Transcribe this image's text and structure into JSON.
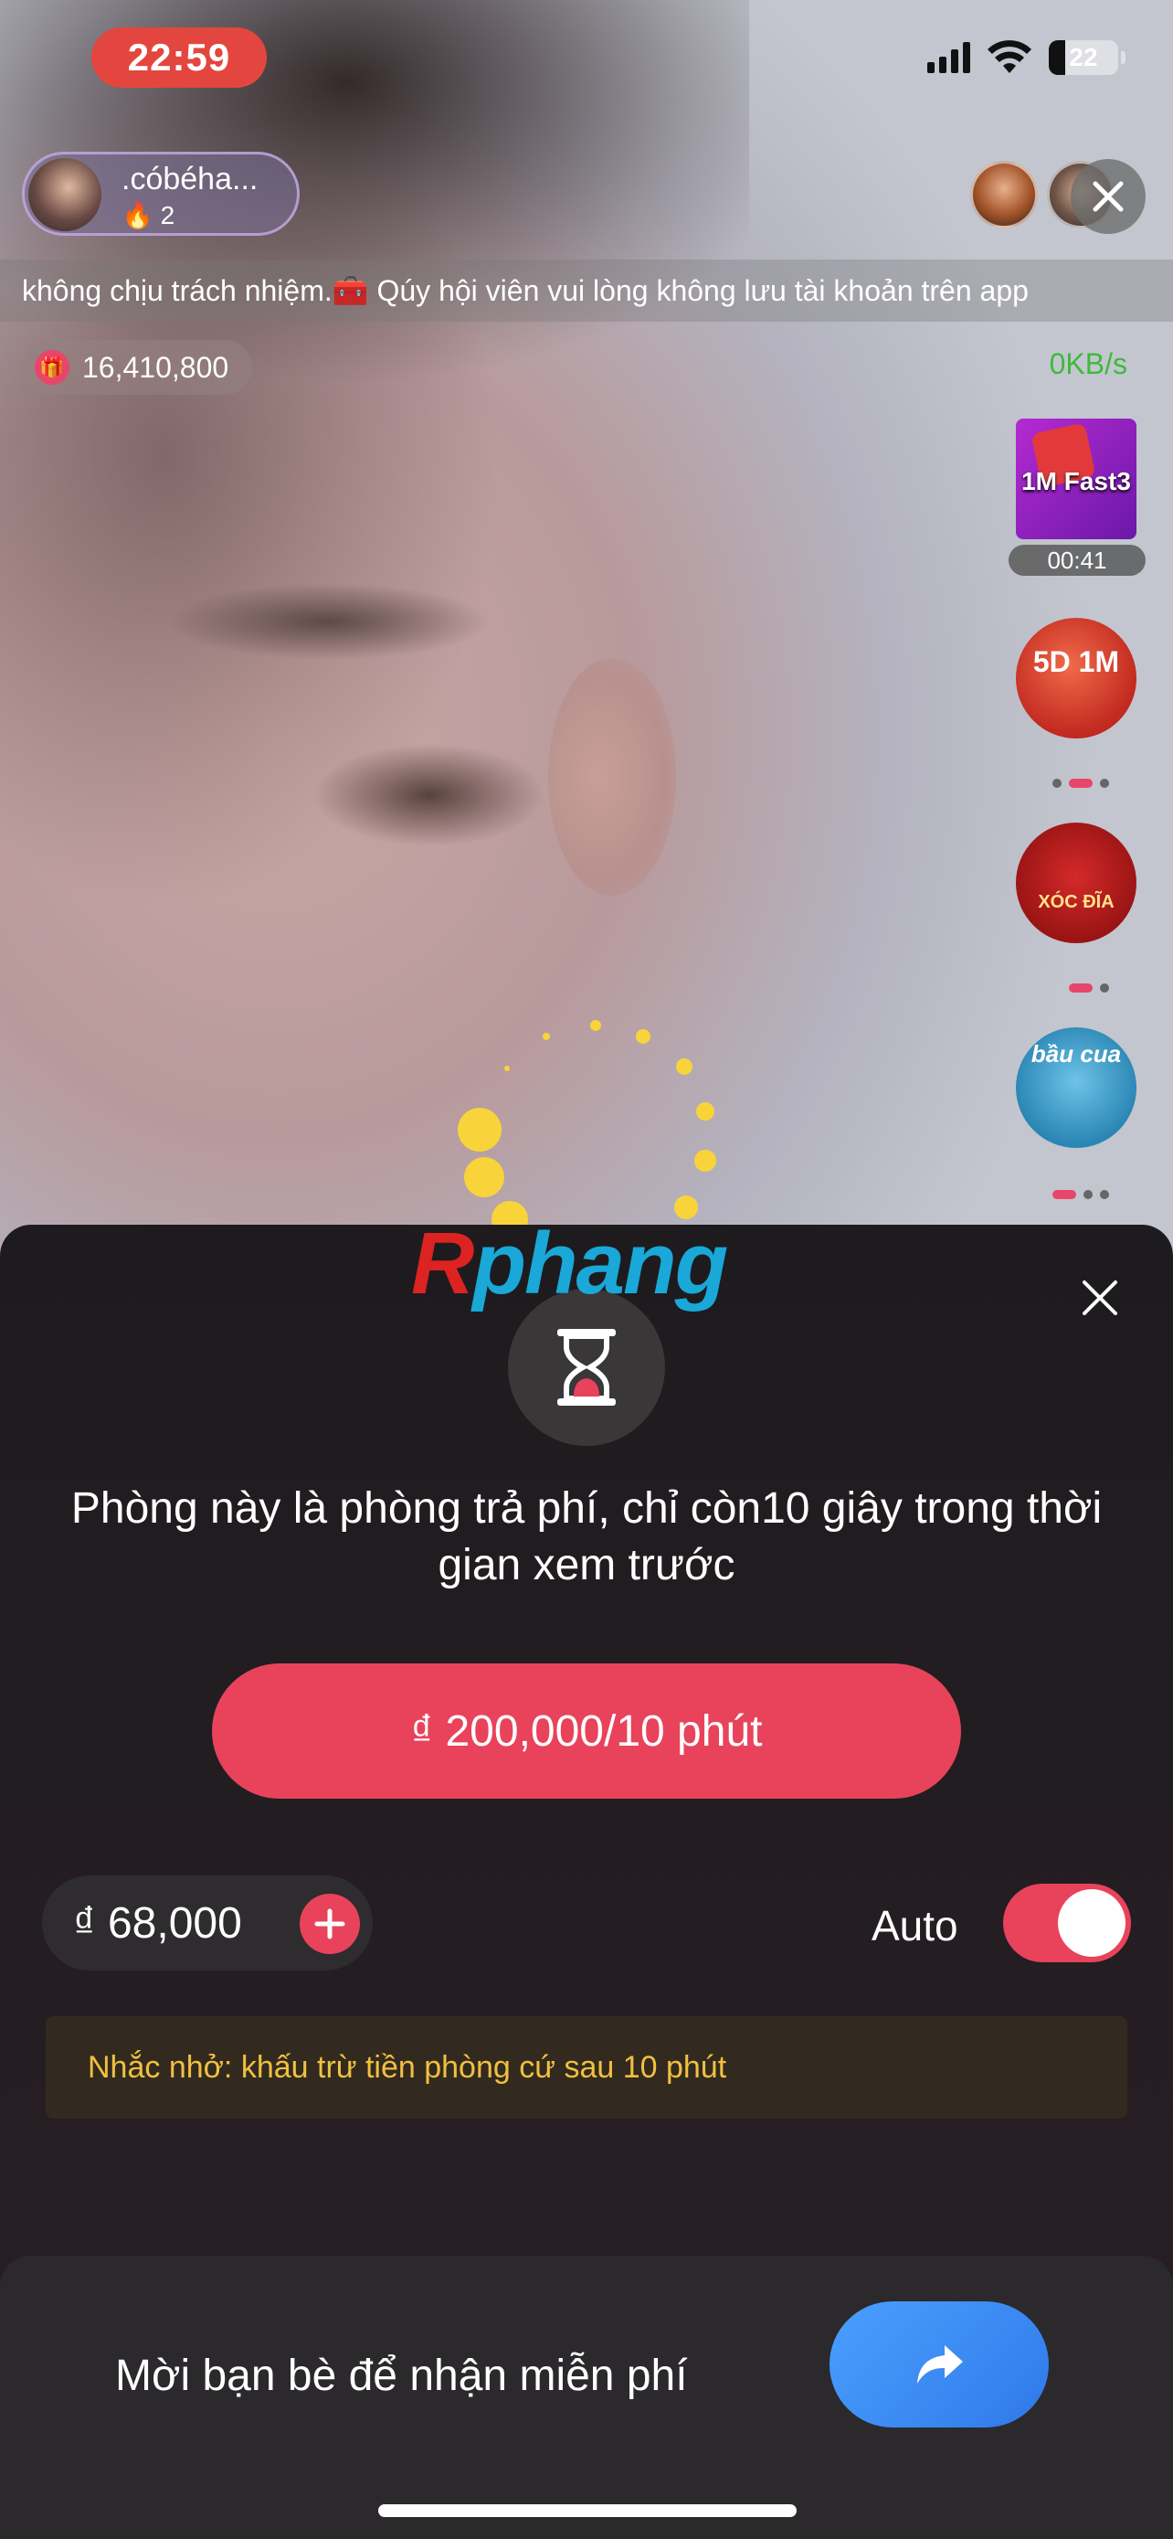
{
  "status_bar": {
    "time": "22:59",
    "battery": "22"
  },
  "streamer": {
    "name": ".cóbéha...",
    "fans": "2",
    "fan_icon": "flame-icon"
  },
  "ticker": {
    "text": "không chịu trách nhiệm.🧰 Qúy hội viên vui lòng không lưu tài khoản trên app"
  },
  "gift": {
    "count": "16,410,800",
    "icon": "gift-icon"
  },
  "network_speed": "0KB/s",
  "games": [
    {
      "label": "1M Fast3",
      "timer": "00:41"
    },
    {
      "label": "5D 1M"
    },
    {
      "label": "XÓC ĐĨA"
    },
    {
      "label": "bầu cua"
    }
  ],
  "watermark": {
    "part1": "R",
    "part2": "phang"
  },
  "paywall": {
    "message": "Phòng này là phòng trả phí, chỉ còn10 giây trong thời gian xem trước",
    "pay_button": "₫ 200,000/10 phút",
    "balance": "₫ 68,000",
    "auto_label": "Auto",
    "auto_enabled": true,
    "reminder": "Nhắc nhở: khấu trừ tiền phòng cứ sau 10 phút",
    "invite_text": "Mời bạn bè để nhận miễn phí"
  },
  "colors": {
    "accent": "#e8435b",
    "reminder_text": "#f0c040",
    "share_button": "#3d8cf5",
    "status_time_bg": "#e3463e"
  }
}
